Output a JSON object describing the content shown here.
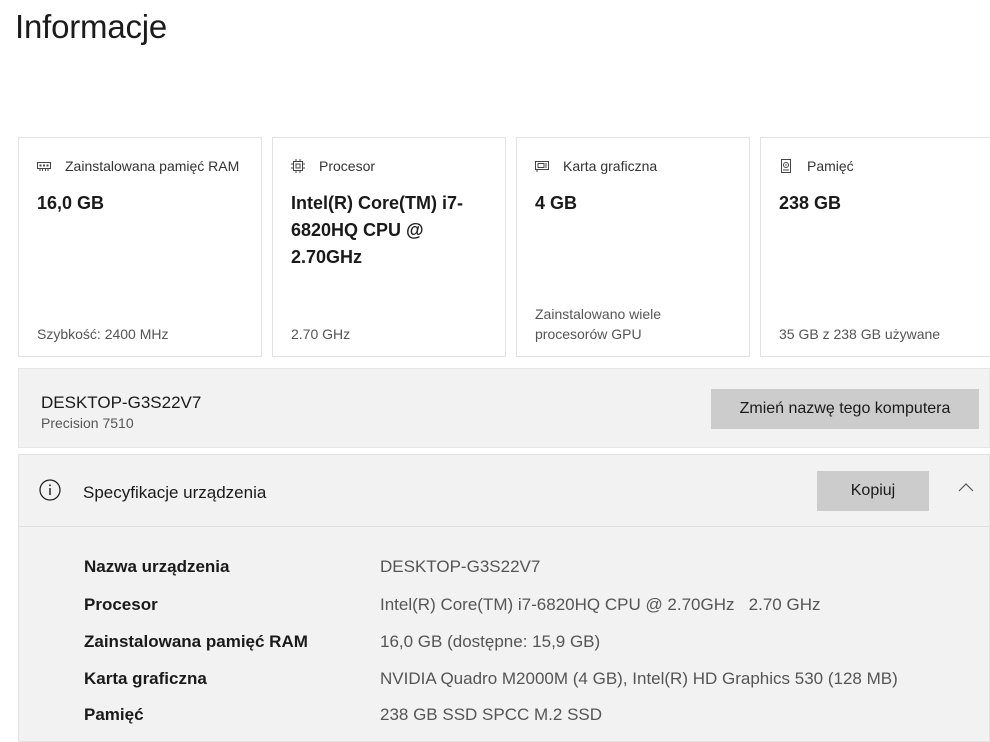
{
  "page": {
    "title": "Informacje"
  },
  "cards": [
    {
      "icon": "ram-icon",
      "label": "Zainstalowana pamięć RAM",
      "value": "16,0 GB",
      "footer": "Szybkość: 2400 MHz"
    },
    {
      "icon": "processor-icon",
      "label": "Procesor",
      "value": "Intel(R) Core(TM) i7-6820HQ CPU @ 2.70GHz",
      "footer": "2.70 GHz"
    },
    {
      "icon": "graphics-card-icon",
      "label": "Karta graficzna",
      "value": "4 GB",
      "footer": "Zainstalowano wiele procesorów GPU"
    },
    {
      "icon": "storage-icon",
      "label": "Pamięć",
      "value": "238 GB",
      "footer": "35 GB z 238 GB używane"
    }
  ],
  "device": {
    "name": "DESKTOP-G3S22V7",
    "model": "Precision 7510",
    "rename_label": "Zmień nazwę tego komputera"
  },
  "spec": {
    "title": "Specyfikacje urządzenia",
    "copy_label": "Kopiuj",
    "rows": [
      {
        "label": "Nazwa urządzenia",
        "value": "DESKTOP-G3S22V7"
      },
      {
        "label": "Procesor",
        "value": "Intel(R) Core(TM) i7-6820HQ CPU @ 2.70GHz   2.70 GHz"
      },
      {
        "label": "Zainstalowana pamięć RAM",
        "value": "16,0 GB (dostępne: 15,9 GB)"
      },
      {
        "label": "Karta graficzna",
        "value": "NVIDIA Quadro M2000M (4 GB), Intel(R) HD Graphics 530 (128 MB)"
      },
      {
        "label": "Pamięć",
        "value": "238 GB SSD SPCC M.2 SSD"
      }
    ]
  }
}
